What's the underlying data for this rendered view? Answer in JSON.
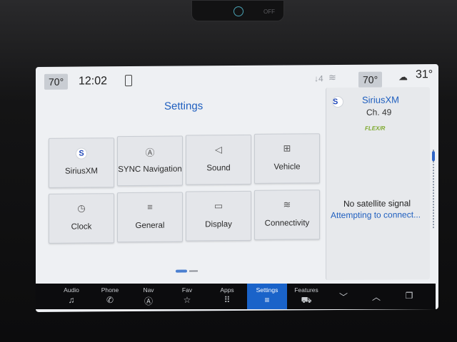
{
  "header": {
    "inside_temp": "70°",
    "clock": "12:02",
    "cabin_temp": "70°",
    "outside_temp": "31°",
    "network_icon": "↓4",
    "wifi_icon": "wifi-icon"
  },
  "dash_button": {
    "label": "OFF"
  },
  "page": {
    "title": "Settings"
  },
  "tiles": [
    {
      "label": "SiriusXM",
      "icon": "S"
    },
    {
      "label": "SYNC Navigation",
      "icon": "Ⓐ"
    },
    {
      "label": "Sound",
      "icon": "◁"
    },
    {
      "label": "Vehicle",
      "icon": "⊞"
    },
    {
      "label": "Clock",
      "icon": "◷"
    },
    {
      "label": "General",
      "icon": "≡"
    },
    {
      "label": "Display",
      "icon": "▭"
    },
    {
      "label": "Connectivity",
      "icon": "≋"
    }
  ],
  "side_panel": {
    "service": "SiriusXM",
    "channel": "Ch. 49",
    "station_logo": "FLEX/R",
    "status": "No satellite signal",
    "substatus": "Attempting to connect..."
  },
  "nav": [
    {
      "label": "Audio",
      "icon": "♫"
    },
    {
      "label": "Phone",
      "icon": "✆"
    },
    {
      "label": "Nav",
      "icon": "Ⓐ"
    },
    {
      "label": "Fav",
      "icon": "☆"
    },
    {
      "label": "Apps",
      "icon": "⠿"
    },
    {
      "label": "Settings",
      "icon": "≡"
    },
    {
      "label": "Features",
      "icon": "⛟"
    },
    {
      "label": "",
      "icon": "﹀"
    },
    {
      "label": "",
      "icon": "︿"
    },
    {
      "label": "",
      "icon": "❐"
    }
  ]
}
